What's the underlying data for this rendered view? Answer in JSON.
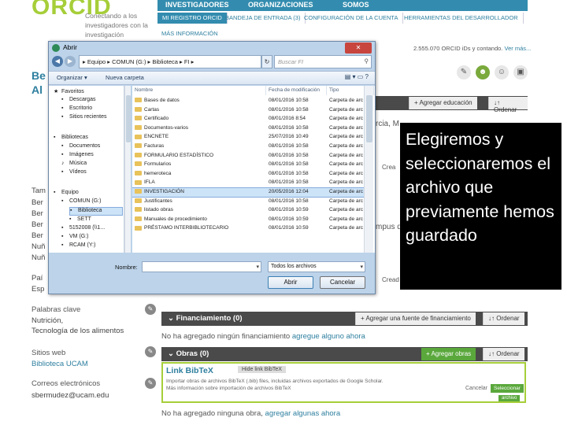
{
  "orcid": {
    "logo": "ORCID",
    "tagline": "Conectando a los investigadores con la investigación",
    "topnav": [
      "INVESTIGADORES",
      "ORGANIZACIONES",
      "SOMOS"
    ],
    "subnav": [
      "MI REGISTRO ORCID",
      "BANDEJA DE ENTRADA (3)",
      "CONFIGURACIÓN DE LA CUENTA",
      "HERRAMIENTAS DEL DESARROLLADOR"
    ],
    "more_info": "MÁS INFORMACIÓN",
    "id_count": "2.555.070 ORCID iDs y contando.",
    "see_more": "Ver más...",
    "name_fragments": [
      "Be",
      "Al"
    ],
    "left_labels": [
      "Tam",
      "Ber",
      "Ber",
      "Ber",
      "Ber",
      "Nuñ",
      "Nuñ",
      "Paí",
      "Esp"
    ],
    "keywords_label": "Palabras clave",
    "keywords": [
      "Nutrición,",
      "Tecnología de los alimentos"
    ],
    "websites_label": "Sitios web",
    "website": "Biblioteca UCAM",
    "emails_label": "Correos electrónicos",
    "email": "sbermudez@ucam.edu",
    "education_add": "+ Agregar educación",
    "sort": "↓↑ Ordenar",
    "name_snippet": "rcia, M",
    "create_frag": "Crea",
    "campus_frag": "mpus d",
    "created_frag": "Cread",
    "funding": {
      "title": "⌄ Financiamiento (0)",
      "add": "+ Agregar una fuente de financiamiento",
      "sort": "↓↑ Ordenar",
      "empty_text": "No ha agregado ningún financiamiento",
      "empty_link": "agregue alguno ahora"
    },
    "works": {
      "title": "⌄ Obras (0)",
      "add": "+ Agregar obras",
      "sort": "↓↑ Ordenar",
      "empty_text": "No ha agregado ninguna obra,",
      "empty_link": "agregar algunas ahora"
    },
    "bibtex": {
      "title": "Link BibTeX",
      "hide": "Hide link BibTeX",
      "desc": "Importar obras de archivos BibTeX (.bib) files, incluidas archivos exportados de Google Scholar.",
      "more": "Más información sobre importación de archivos BibTeX",
      "cancel": "Cancelar",
      "select": "Seleccionar",
      "select2": "archivo"
    }
  },
  "dialog": {
    "title": "Abrir",
    "close": "✕",
    "address": "▸ Equipo ▸ COMUN (G:) ▸ Biblioteca ▸ FI ▸",
    "search_placeholder": "Buscar FI",
    "toolbar": {
      "organize": "Organizar ▾",
      "new_folder": "Nueva carpeta"
    },
    "nav": [
      {
        "label": "Favoritos",
        "icon": "★"
      },
      {
        "label": "Descargas",
        "icon": "▪"
      },
      {
        "label": "Escritorio",
        "icon": "▪"
      },
      {
        "label": "Sitios recientes",
        "icon": "▪"
      },
      {
        "label": "Bibliotecas",
        "icon": "▪"
      },
      {
        "label": "Documentos",
        "icon": "▪"
      },
      {
        "label": "Imágenes",
        "icon": "▪"
      },
      {
        "label": "Música",
        "icon": "♪"
      },
      {
        "label": "Vídeos",
        "icon": "▪"
      },
      {
        "label": "Equipo",
        "icon": "▪"
      },
      {
        "label": "COMUN (G:)",
        "icon": "▪"
      },
      {
        "label": "Biblioteca",
        "icon": "▪"
      },
      {
        "label": "SETT",
        "icon": "▪"
      },
      {
        "label": "5152008 (\\\\1...",
        "icon": "▪"
      },
      {
        "label": "VM (G:)",
        "icon": "▪"
      },
      {
        "label": "RCAM (Y:)",
        "icon": "▪"
      }
    ],
    "columns": [
      "Nombre",
      "Fecha de modificación",
      "Tipo"
    ],
    "files": [
      {
        "name": "Bases de datos",
        "date": "08/01/2016 10:58",
        "type": "Carpeta de arc"
      },
      {
        "name": "Cartas",
        "date": "08/01/2016 10:58",
        "type": "Carpeta de arc"
      },
      {
        "name": "Certificado",
        "date": "08/01/2016 8:54",
        "type": "Carpeta de arc"
      },
      {
        "name": "Documentos-varios",
        "date": "08/01/2016 10:58",
        "type": "Carpeta de arc"
      },
      {
        "name": "ENCNETE",
        "date": "25/07/2016 10:49",
        "type": "Carpeta de arc"
      },
      {
        "name": "Facturas",
        "date": "08/01/2016 10:58",
        "type": "Carpeta de arc"
      },
      {
        "name": "FORMULARIO ESTADÍSTICO",
        "date": "08/01/2016 10:58",
        "type": "Carpeta de arc"
      },
      {
        "name": "Formularios",
        "date": "08/01/2016 10:58",
        "type": "Carpeta de arc"
      },
      {
        "name": "hemeroteca",
        "date": "08/01/2016 10:58",
        "type": "Carpeta de arc"
      },
      {
        "name": "IFLA",
        "date": "08/01/2016 10:58",
        "type": "Carpeta de arc"
      },
      {
        "name": "INVESTIGACIÓN",
        "date": "20/05/2016 12:04",
        "type": "Carpeta de arc"
      },
      {
        "name": "Justificantes",
        "date": "08/01/2016 10:58",
        "type": "Carpeta de arc"
      },
      {
        "name": "listado obras",
        "date": "08/01/2016 10:59",
        "type": "Carpeta de arc"
      },
      {
        "name": "Manuales de procedimiento",
        "date": "08/01/2016 10:59",
        "type": "Carpeta de arc"
      },
      {
        "name": "PRÉSTAMO INTERBIBLIOTECARIO",
        "date": "08/01/2016 10:59",
        "type": "Carpeta de arc"
      }
    ],
    "selected_file_index": 10,
    "name_label": "Nombre:",
    "type_select": "Todos los archivos",
    "open": "Abrir",
    "cancel": "Cancelar"
  },
  "caption": "Elegiremos y seleccionaremos el archivo que previamente hemos guardado"
}
